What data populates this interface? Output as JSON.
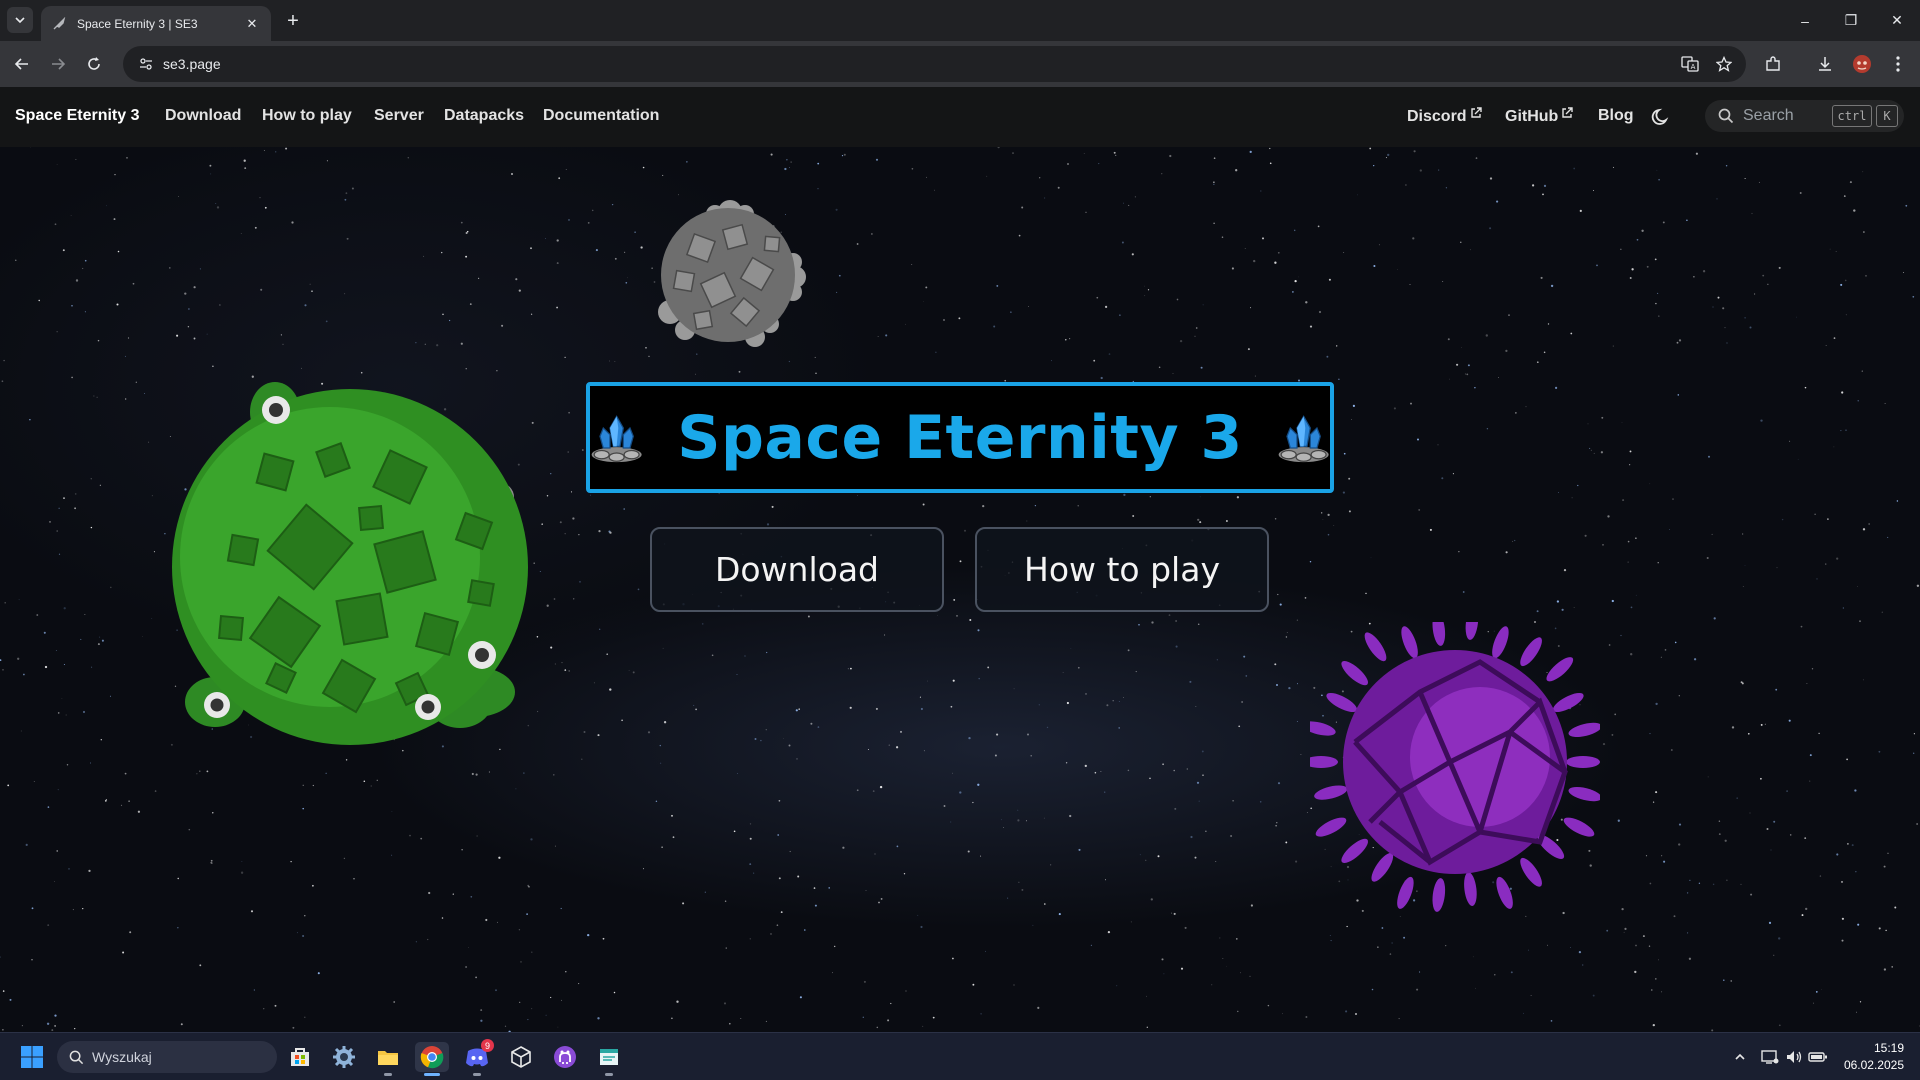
{
  "browser": {
    "tab_title": "Space Eternity 3 | SE3",
    "tab_close": "✕",
    "new_tab": "+",
    "url": "se3.page",
    "window_controls": [
      "–",
      "❐",
      "✕"
    ]
  },
  "nav": {
    "brand": "Space Eternity 3",
    "links": [
      "Download",
      "How to play",
      "Server",
      "Datapacks",
      "Documentation"
    ],
    "right_links": [
      "Discord",
      "GitHub",
      "Blog"
    ],
    "search_placeholder": "Search",
    "search_kbd": [
      "ctrl",
      "K"
    ]
  },
  "hero": {
    "title": "Space Eternity 3",
    "buttons": [
      "Download",
      "How to play"
    ]
  },
  "taskbar": {
    "search_text": "Wyszukaj",
    "discord_badge": "9",
    "time": "15:19",
    "date": "06.02.2025"
  },
  "colors": {
    "accent": "#1aa8ea",
    "nav_bg": "#141516",
    "planet_green": "#3aa52e",
    "planet_purple": "#7a1fa8",
    "planet_grey": "#7a7a7a"
  },
  "icons": {
    "tab_search": "chevron-down-icon",
    "back": "back-arrow-icon",
    "forward": "forward-arrow-icon",
    "reload": "reload-icon",
    "site_info": "site-info-icon",
    "translate": "translate-icon",
    "bookmark": "star-icon",
    "extensions": "puzzle-icon",
    "download": "download-icon",
    "profile": "profile-avatar-icon",
    "menu": "kebab-menu-icon",
    "theme": "moon-icon",
    "search": "search-icon",
    "crystal": "crystal-icon"
  }
}
